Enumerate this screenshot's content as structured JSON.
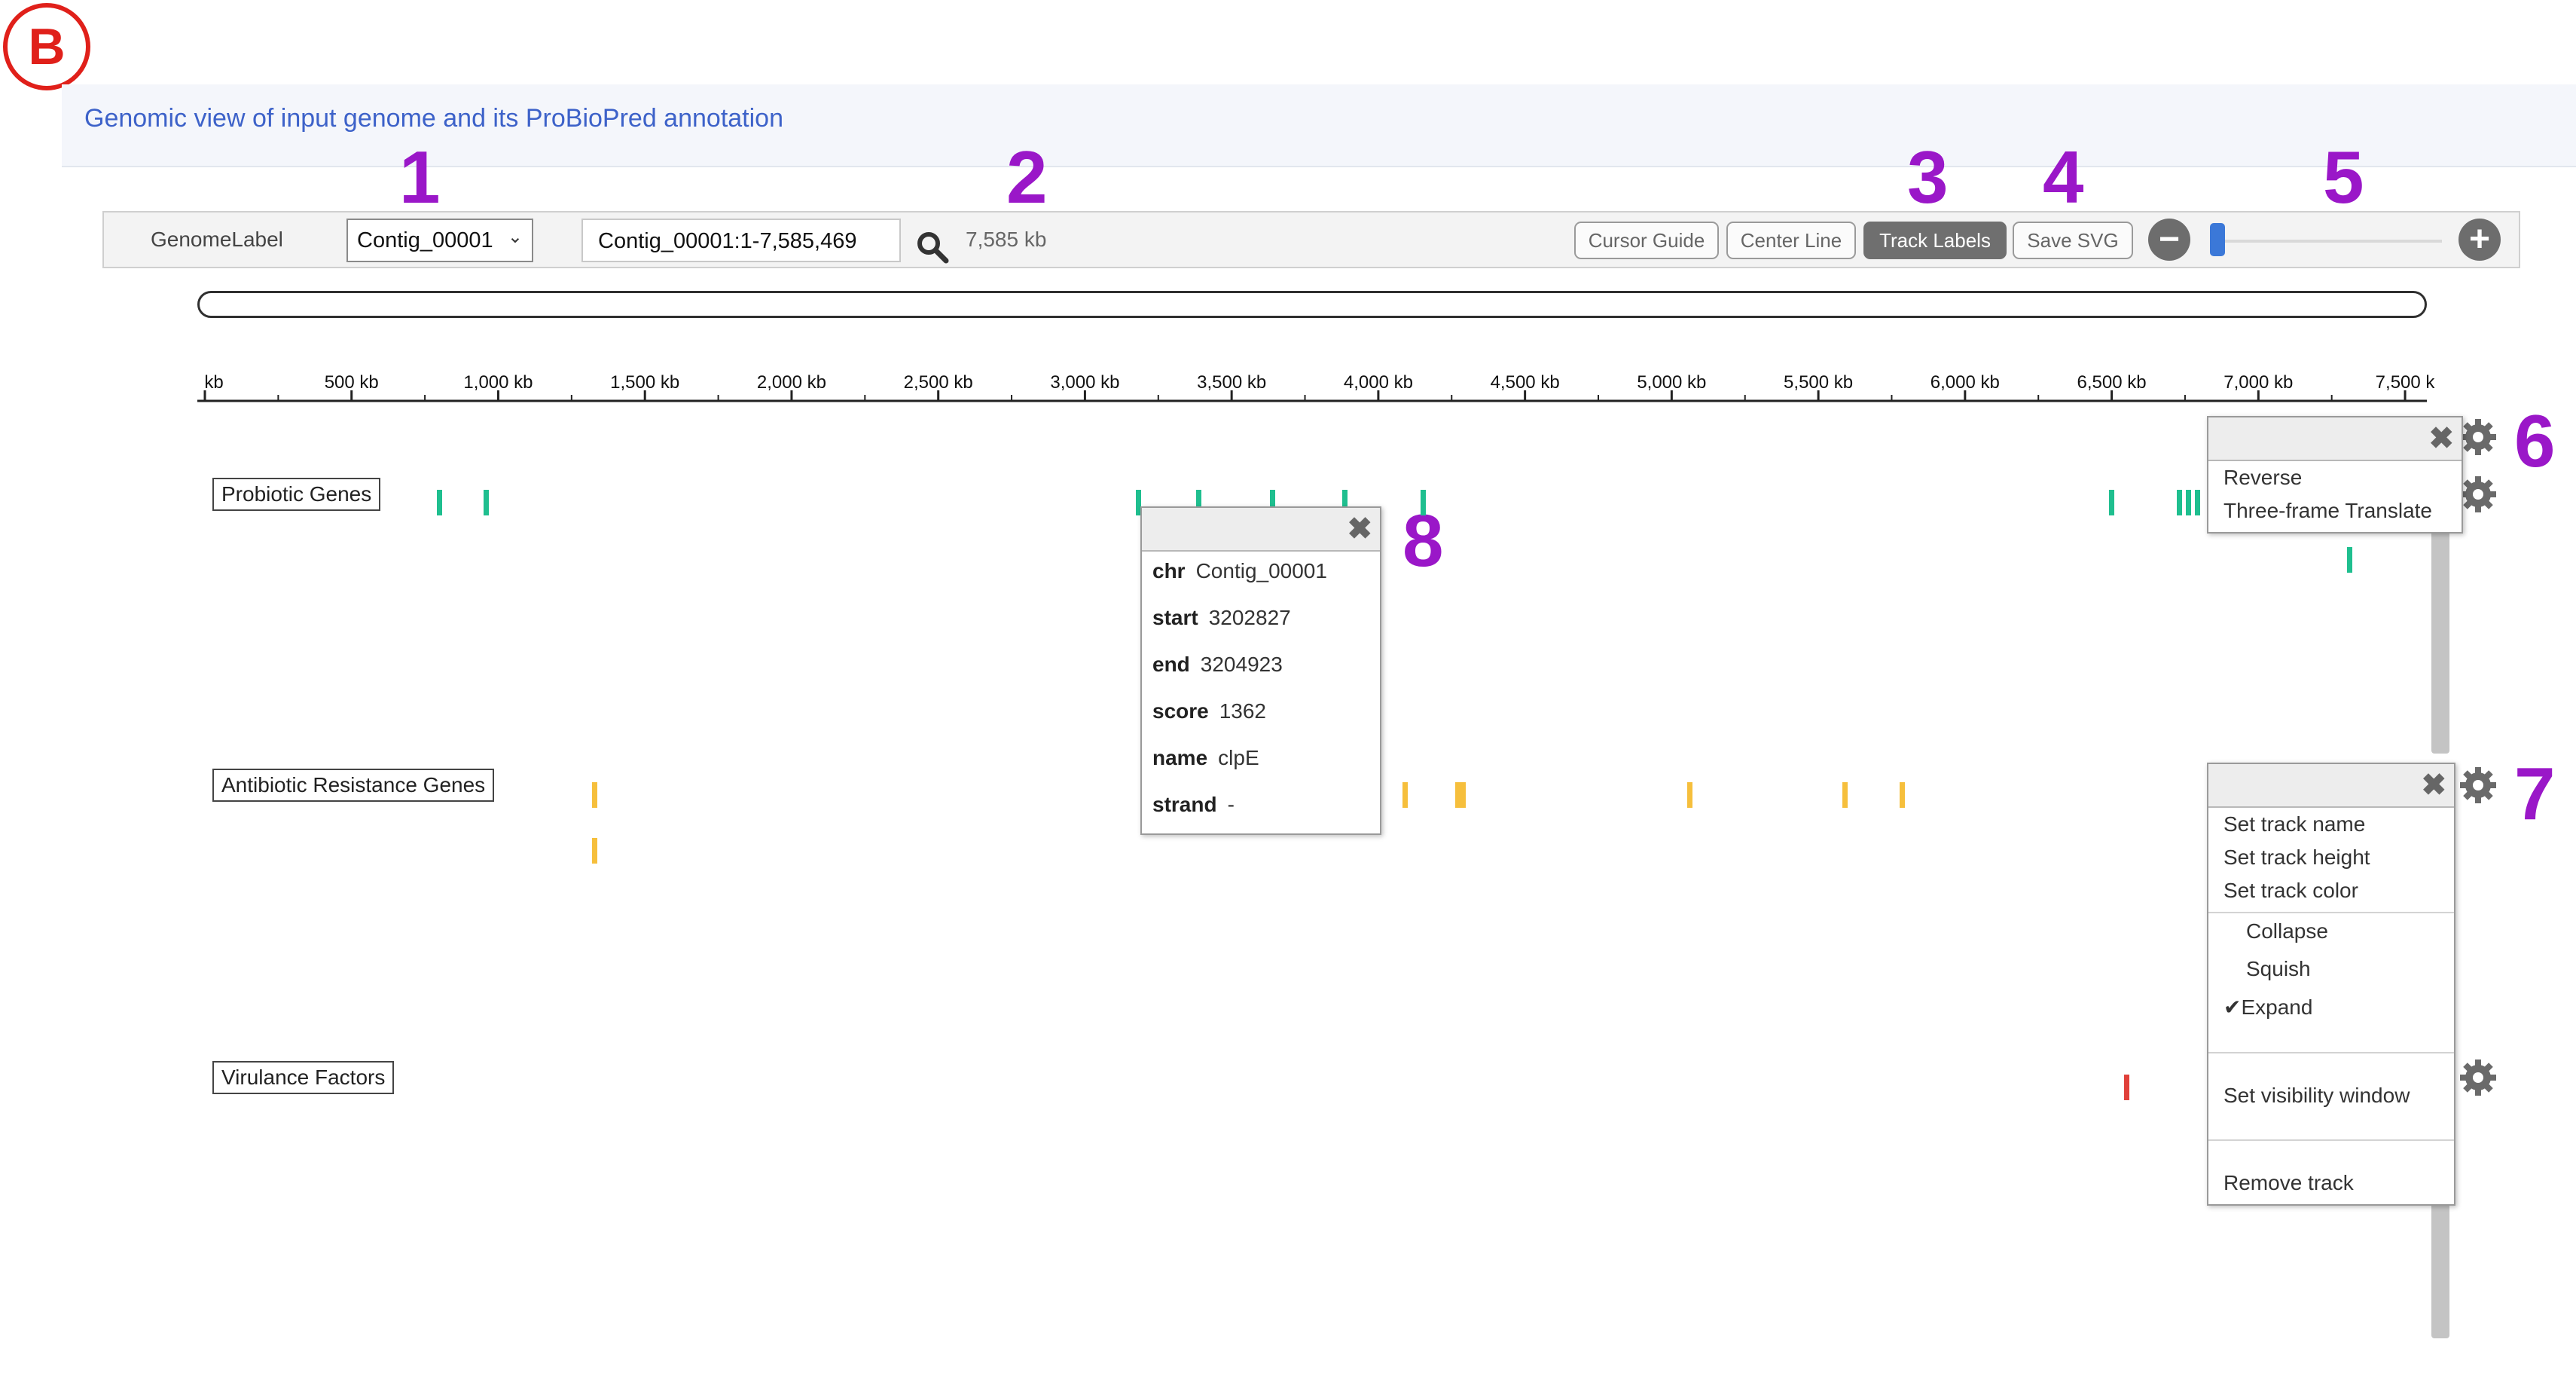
{
  "panel_label": "B",
  "header": {
    "title": "Genomic view of input genome and its ProBioPred annotation"
  },
  "callouts": [
    "1",
    "2",
    "3",
    "4",
    "5",
    "6",
    "7",
    "8"
  ],
  "toolbar": {
    "genome_label": "GenomeLabel",
    "contig_select": "Contig_00001",
    "locus": "Contig_00001:1-7,585,469",
    "locus_size": "7,585 kb",
    "buttons": {
      "cursor_guide": "Cursor Guide",
      "center_line": "Center Line",
      "track_labels": "Track Labels",
      "save_svg": "Save SVG"
    },
    "zoom_out": "−",
    "zoom_in": "+",
    "zoom_level_fraction": 0.0
  },
  "ruler": {
    "ticks": [
      "kb",
      "500 kb",
      "1,000 kb",
      "1,500 kb",
      "2,000 kb",
      "2,500 kb",
      "3,000 kb",
      "3,500 kb",
      "4,000 kb",
      "4,500 kb",
      "5,000 kb",
      "5,500 kb",
      "6,000 kb",
      "6,500 kb",
      "7,000 kb",
      "7,500 k"
    ]
  },
  "tracks": {
    "probiotic": {
      "label": "Probiotic Genes",
      "color": "#1fbf8f"
    },
    "antibiotic": {
      "label": "Antibiotic Resistance Genes",
      "color": "#f6bf3c"
    },
    "virulence": {
      "label": "Virulance Factors",
      "color": "#e0403a"
    }
  },
  "sequence_menu": {
    "items": [
      "Reverse",
      "Three-frame Translate"
    ]
  },
  "track_menu": {
    "items": [
      "Set track name",
      "Set track height",
      "Set track color",
      "Collapse",
      "Squish",
      "Expand",
      "Set visibility window",
      "Remove track"
    ],
    "checked": "Expand",
    "check_mark": "✔"
  },
  "feature_popup": {
    "rows": [
      {
        "key": "chr",
        "value": "Contig_00001"
      },
      {
        "key": "start",
        "value": "3202827"
      },
      {
        "key": "end",
        "value": "3204923"
      },
      {
        "key": "score",
        "value": "1362"
      },
      {
        "key": "name",
        "value": "clpE"
      },
      {
        "key": "strand",
        "value": "-"
      }
    ]
  },
  "close_glyph": "✖"
}
